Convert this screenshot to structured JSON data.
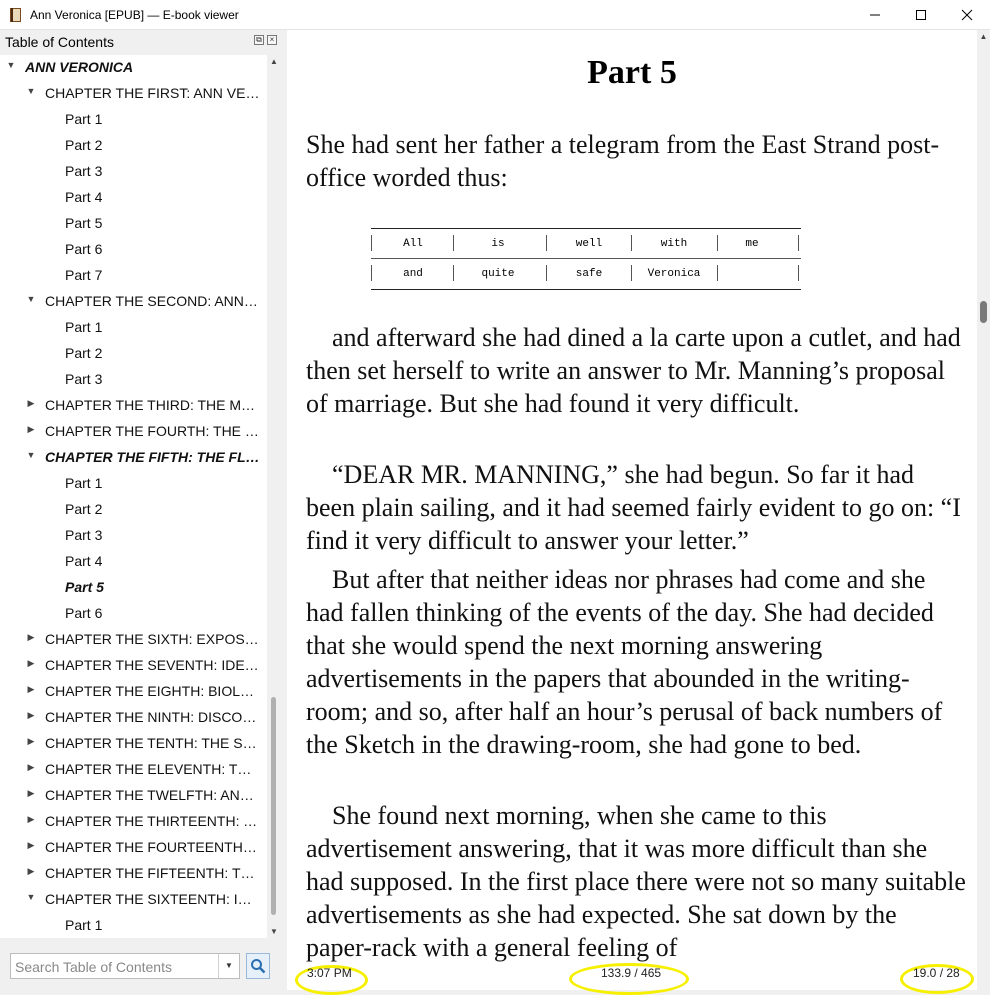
{
  "window": {
    "title": "Ann Veronica [EPUB] — E-book viewer",
    "minimize_glyph": "—",
    "maximize_glyph": "☐",
    "close_glyph": "✕"
  },
  "sidebar": {
    "header": "Table of Contents",
    "search_placeholder": "Search Table of Contents",
    "toc": [
      {
        "label": "ANN VERONICA",
        "level": 0,
        "expanded": true,
        "bold": true
      },
      {
        "label": "CHAPTER THE FIRST: ANN VERONICA TALKS TO HER FATHER",
        "level": 1,
        "expanded": true
      },
      {
        "label": "Part 1",
        "level": 2
      },
      {
        "label": "Part 2",
        "level": 2
      },
      {
        "label": "Part 3",
        "level": 2
      },
      {
        "label": "Part 4",
        "level": 2
      },
      {
        "label": "Part 5",
        "level": 2
      },
      {
        "label": "Part 6",
        "level": 2
      },
      {
        "label": "Part 7",
        "level": 2
      },
      {
        "label": "CHAPTER THE SECOND: ANN VERONICA GATHERS POINTS OF VIEW",
        "level": 1,
        "expanded": true
      },
      {
        "label": "Part 1",
        "level": 2
      },
      {
        "label": "Part 2",
        "level": 2
      },
      {
        "label": "Part 3",
        "level": 2
      },
      {
        "label": "CHAPTER THE THIRD: THE MONDAY MORNING",
        "level": 1,
        "expanded": false
      },
      {
        "label": "CHAPTER THE FOURTH: THE CRISIS",
        "level": 1,
        "expanded": false
      },
      {
        "label": "CHAPTER THE FIFTH: THE FLIGHT TO LONDON",
        "level": 1,
        "expanded": true,
        "bold": true
      },
      {
        "label": "Part 1",
        "level": 2
      },
      {
        "label": "Part 2",
        "level": 2
      },
      {
        "label": "Part 3",
        "level": 2
      },
      {
        "label": "Part 4",
        "level": 2
      },
      {
        "label": "Part 5",
        "level": 2,
        "bold": true
      },
      {
        "label": "Part 6",
        "level": 2
      },
      {
        "label": "CHAPTER THE SIXTH: EXPOSTULATIONS",
        "level": 1,
        "expanded": false
      },
      {
        "label": "CHAPTER THE SEVENTH: IDEALS AND A REALITY",
        "level": 1,
        "expanded": false
      },
      {
        "label": "CHAPTER THE EIGHTH: BIOLOGY",
        "level": 1,
        "expanded": false
      },
      {
        "label": "CHAPTER THE NINTH: DISCORDS",
        "level": 1,
        "expanded": false
      },
      {
        "label": "CHAPTER THE TENTH: THE SUFFRAGETTES",
        "level": 1,
        "expanded": false
      },
      {
        "label": "CHAPTER THE ELEVENTH: THOUGHTS IN PRISON",
        "level": 1,
        "expanded": false
      },
      {
        "label": "CHAPTER THE TWELFTH: ANN VERONICA PREPARES",
        "level": 1,
        "expanded": false
      },
      {
        "label": "CHAPTER THE THIRTEENTH: THE ENDING OF THE ENGAGEMENT",
        "level": 1,
        "expanded": false
      },
      {
        "label": "CHAPTER THE FOURTEENTH: THE SPEECHES",
        "level": 1,
        "expanded": false
      },
      {
        "label": "CHAPTER THE FIFTEENTH: THE OPENING OF THE DOOR",
        "level": 1,
        "expanded": false
      },
      {
        "label": "CHAPTER THE SIXTEENTH: IN THE MOUNTAINS",
        "level": 1,
        "expanded": true
      },
      {
        "label": "Part 1",
        "level": 2
      }
    ]
  },
  "reader": {
    "heading": "Part 5",
    "p1": "She had sent her father a telegram from the East Strand post-office worded thus:",
    "telegram_row1": [
      "All",
      "is",
      "well",
      "with",
      "me"
    ],
    "telegram_row2": [
      "and",
      "quite",
      "safe",
      "Veronica",
      ""
    ],
    "p2": "and afterward she had dined a la carte upon a cutlet, and had then set herself to write an answer to Mr. Manning’s proposal of marriage. But she had found it very difficult.",
    "p3": "“DEAR MR. MANNING,” she had begun. So far it had been plain sailing, and it had seemed fairly evident to go on: “I find it very difficult to answer your letter.”",
    "p4": "But after that neither ideas nor phrases had come and she had fallen thinking of the events of the day. She had decided that she would spend the next morning answering advertisements in the papers that abounded in the writing-room; and so, after half an hour’s perusal of back numbers of the Sketch in the drawing-room, she had gone to bed.",
    "p5": "She found next morning, when she came to this advertisement answering, that it was more difficult than she had supposed. In the first place there were not so many suitable advertisements as she had expected. She sat down by the paper-rack with a general feeling of"
  },
  "status": {
    "time": "3:07 PM",
    "position": "133.9 / 465",
    "page": "19.0 / 28",
    "highlight_color": "#f6f000"
  }
}
